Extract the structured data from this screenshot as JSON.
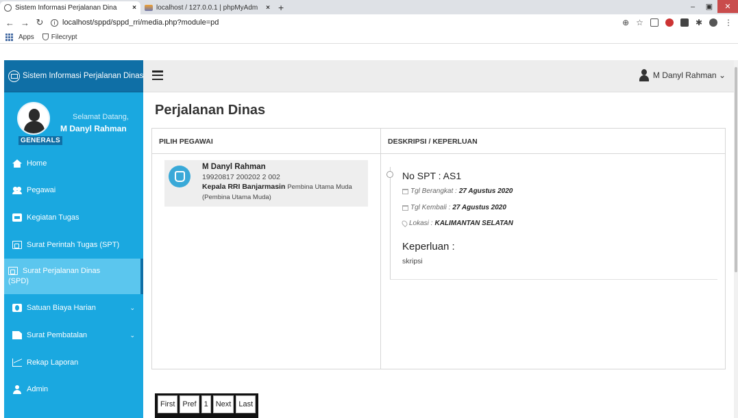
{
  "browser": {
    "tabs": [
      {
        "title": "Sistem Informasi Perjalanan Dina",
        "close": "×",
        "active": true
      },
      {
        "title": "localhost / 127.0.0.1 | phpMyAdm",
        "close": "×",
        "active": false
      }
    ],
    "new_tab": "+",
    "url": "localhost/sppd/sppd_rri/media.php?module=pd",
    "bookmarks": [
      {
        "label": "Apps",
        "icon": "apps-grid-icon"
      },
      {
        "label": "Filecrypt",
        "icon": "shield-icon"
      }
    ]
  },
  "sidebar": {
    "brand": "Sistem Informasi Perjalanan Dinas",
    "welcome": "Selamat Datang,",
    "user_name": "M Danyl Rahman",
    "role": "GENERALS",
    "items": [
      {
        "label": "Home",
        "icon": "home-icon"
      },
      {
        "label": "Pegawai",
        "icon": "users-icon"
      },
      {
        "label": "Kegiatan Tugas",
        "icon": "id-card-icon"
      },
      {
        "label": "Surat Perintah Tugas (SPT)",
        "icon": "pdf-icon"
      },
      {
        "label": "Surat Perjalanan Dinas",
        "label2": "(SPD)",
        "icon": "pdf-icon",
        "active": true
      },
      {
        "label": "Satuan Biaya Harian",
        "icon": "money-icon",
        "chevron": "⌄"
      },
      {
        "label": "Surat Pembatalan",
        "icon": "file-icon",
        "chevron": "⌄"
      },
      {
        "label": "Rekap Laporan",
        "icon": "line-chart-icon"
      },
      {
        "label": "Admin",
        "icon": "user-icon"
      }
    ]
  },
  "topnav": {
    "user_label": "M Danyl Rahman ⌄"
  },
  "page": {
    "title": "Perjalanan Dinas",
    "col_pegawai": "PILIH PEGAWAI",
    "col_deskripsi": "DESKRIPSI / KEPERLUAN"
  },
  "employee": {
    "name": "M Danyl Rahman",
    "nip": "19920817 200202 2 002",
    "position": "Kepala RRI Banjarmasin",
    "rank": "Pembina Utama Muda",
    "rank_paren": "(Pembina Utama Muda)"
  },
  "trip": {
    "spt_no": "No SPT : AS1",
    "depart_label": "Tgl Berangkat :",
    "depart_value": "27 Agustus 2020",
    "return_label": "Tgl Kembali :",
    "return_value": "27 Agustus 2020",
    "location_label": "Lokasi :",
    "location_value": "KALIMANTAN SELATAN",
    "purpose_label": "Keperluan :",
    "purpose_value": "skripsi"
  },
  "pagination": [
    "First",
    "Pref",
    "1",
    "Next",
    "Last"
  ]
}
